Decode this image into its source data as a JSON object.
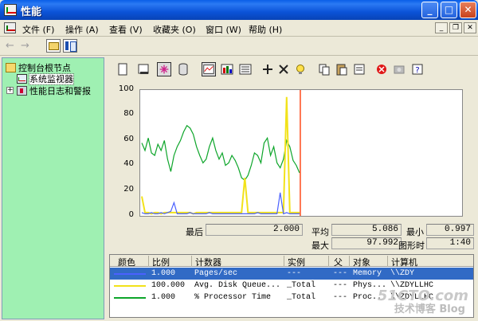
{
  "window": {
    "title": "性能"
  },
  "menu": {
    "items": [
      "文件 (F)",
      "操作 (A)",
      "查看 (V)",
      "收藏夹 (O)",
      "窗口 (W)",
      "帮助 (H)"
    ]
  },
  "tree": {
    "root": "控制台根节点",
    "monitor": "系统监视器",
    "logs": "性能日志和警报"
  },
  "graph": {
    "y_ticks": [
      "100",
      "80",
      "60",
      "40",
      "20",
      "0"
    ]
  },
  "stats": {
    "last_label": "最后",
    "last_value": "2.000",
    "avg_label": "平均",
    "avg_value": "5.086",
    "min_label": "最小",
    "min_value": "0.997",
    "max_label": "最大",
    "max_value": "97.992",
    "duration_label": "图形时间",
    "duration_value": "1:40"
  },
  "legend": {
    "headers": [
      "颜色",
      "比例",
      "计数器",
      "实例",
      "父",
      "对象",
      "计算机"
    ],
    "rows": [
      {
        "color": "#4a60ff",
        "scale": "1.000",
        "counter": "Pages/sec",
        "instance": "---",
        "parent": "---",
        "object": "Memory",
        "computer": "\\\\ZDY"
      },
      {
        "color": "#f2e21a",
        "scale": "100.000",
        "counter": "Avg. Disk Queue...",
        "instance": "_Total",
        "parent": "---",
        "object": "Phys...",
        "computer": "\\\\ZDYLLHC"
      },
      {
        "color": "#0da52a",
        "scale": "1.000",
        "counter": "% Processor Time",
        "instance": "_Total",
        "parent": "---",
        "object": "Proc...",
        "computer": "\\\\ZDYLLHC"
      }
    ]
  },
  "watermark": {
    "line1": "51CTO.com",
    "line2": "技术博客 Blog"
  },
  "colors": {
    "series_pages": "#4a60ff",
    "series_disk": "#f2e21a",
    "series_cpu": "#0da52a",
    "cursor": "#ff4a1a",
    "tree_bg": "#9ff0b2"
  },
  "chart_data": {
    "type": "line",
    "ylim": [
      0,
      100
    ],
    "series": [
      {
        "name": "% Processor Time",
        "values": [
          58,
          52,
          62,
          50,
          48,
          57,
          52,
          60,
          45,
          35,
          48,
          55,
          60,
          67,
          72,
          70,
          65,
          55,
          48,
          42,
          45,
          55,
          62,
          52,
          45,
          50,
          40,
          42,
          48,
          44,
          38,
          30,
          28,
          32,
          40,
          50,
          48,
          42,
          58,
          62,
          48,
          55,
          42,
          38,
          45,
          60,
          55,
          44,
          40,
          34
        ]
      },
      {
        "name": "Avg. Disk Queue...",
        "values": [
          15,
          2,
          2,
          1,
          2,
          2,
          1,
          2,
          2,
          2,
          2,
          2,
          2,
          2,
          2,
          2,
          1,
          2,
          2,
          2,
          2,
          2,
          2,
          2,
          2,
          2,
          2,
          2,
          2,
          2,
          2,
          2,
          30,
          2,
          2,
          2,
          2,
          2,
          2,
          2,
          2,
          2,
          2,
          2,
          2,
          95,
          2,
          2,
          2,
          2
        ]
      },
      {
        "name": "Pages/sec",
        "values": [
          2,
          1,
          1,
          2,
          1,
          1,
          2,
          1,
          2,
          3,
          10,
          1,
          1,
          1,
          1,
          2,
          1,
          1,
          1,
          1,
          1,
          2,
          1,
          1,
          1,
          1,
          1,
          1,
          1,
          1,
          1,
          1,
          1,
          1,
          1,
          1,
          2,
          1,
          1,
          1,
          1,
          1,
          1,
          18,
          1,
          2,
          1,
          1,
          1,
          1
        ]
      }
    ]
  }
}
